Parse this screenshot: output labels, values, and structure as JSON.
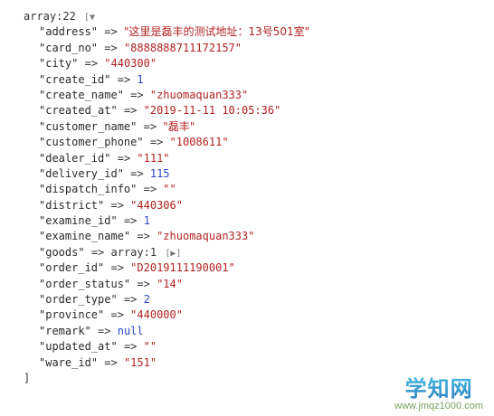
{
  "dump": {
    "header_label": "array:22",
    "toggle_open": "[▼",
    "closing_bracket": "]",
    "arrow": "=>",
    "entries": [
      {
        "key": "\"address\"",
        "value": "\"这里是磊丰的测试地址：13号501室\"",
        "type": "string"
      },
      {
        "key": "\"card_no\"",
        "value": "\"8888888711172157\"",
        "type": "string"
      },
      {
        "key": "\"city\"",
        "value": "\"440300\"",
        "type": "string"
      },
      {
        "key": "\"create_id\"",
        "value": "1",
        "type": "number"
      },
      {
        "key": "\"create_name\"",
        "value": "\"zhuomaquan333\"",
        "type": "string"
      },
      {
        "key": "\"created_at\"",
        "value": "\"2019-11-11 10:05:36\"",
        "type": "string"
      },
      {
        "key": "\"customer_name\"",
        "value": "\"磊丰\"",
        "type": "string"
      },
      {
        "key": "\"customer_phone\"",
        "value": "\"1008611\"",
        "type": "string"
      },
      {
        "key": "\"dealer_id\"",
        "value": "\"111\"",
        "type": "string"
      },
      {
        "key": "\"delivery_id\"",
        "value": "115",
        "type": "number"
      },
      {
        "key": "\"dispatch_info\"",
        "value": "\"\"",
        "type": "string"
      },
      {
        "key": "\"district\"",
        "value": "\"440306\"",
        "type": "string"
      },
      {
        "key": "\"examine_id\"",
        "value": "1",
        "type": "number"
      },
      {
        "key": "\"examine_name\"",
        "value": "\"zhuomaquan333\"",
        "type": "string"
      },
      {
        "key": "\"goods\"",
        "value": "array:1",
        "toggle": "[▶]",
        "type": "array"
      },
      {
        "key": "\"order_id\"",
        "value": "\"D2019111190001\"",
        "type": "string"
      },
      {
        "key": "\"order_status\"",
        "value": "\"14\"",
        "type": "string"
      },
      {
        "key": "\"order_type\"",
        "value": "2",
        "type": "number"
      },
      {
        "key": "\"province\"",
        "value": "\"440000\"",
        "type": "string"
      },
      {
        "key": "\"remark\"",
        "value": "null",
        "type": "null"
      },
      {
        "key": "\"updated_at\"",
        "value": "\"\"",
        "type": "string"
      },
      {
        "key": "\"ware_id\"",
        "value": "\"151\"",
        "type": "string"
      }
    ]
  },
  "watermark": {
    "logo": "学知网",
    "url": "www.jmqz1000.com"
  }
}
